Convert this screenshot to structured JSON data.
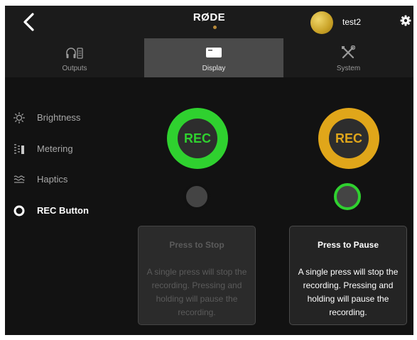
{
  "header": {
    "brand": "RØDE",
    "username": "test2"
  },
  "tabs": [
    {
      "label": "Outputs",
      "icon": "outputs-icon",
      "active": false
    },
    {
      "label": "Display",
      "icon": "display-icon",
      "active": true
    },
    {
      "label": "System",
      "icon": "tools-icon",
      "active": false
    }
  ],
  "sidebar": {
    "items": [
      {
        "label": "Brightness",
        "icon": "sun-icon",
        "active": false
      },
      {
        "label": "Metering",
        "icon": "meter-icon",
        "active": false
      },
      {
        "label": "Haptics",
        "icon": "waves-icon",
        "active": false
      },
      {
        "label": "REC Button",
        "icon": "radio-icon",
        "active": true
      }
    ]
  },
  "options": [
    {
      "rec_label": "REC",
      "ring_color": "#2fd12f",
      "text_color": "#2fd12f",
      "selected": false,
      "title": "Press to Stop",
      "description": "A single press will stop the recording. Pressing and holding will pause the recording."
    },
    {
      "rec_label": "REC",
      "ring_color": "#e0a61a",
      "text_color": "#e0a61a",
      "selected": true,
      "title": "Press to Pause",
      "description": "A single press will stop the recording. Pressing and holding will pause the recording."
    }
  ],
  "colors": {
    "accent_green": "#2fd12f",
    "accent_gold": "#e0a61a",
    "background": "#121212"
  }
}
